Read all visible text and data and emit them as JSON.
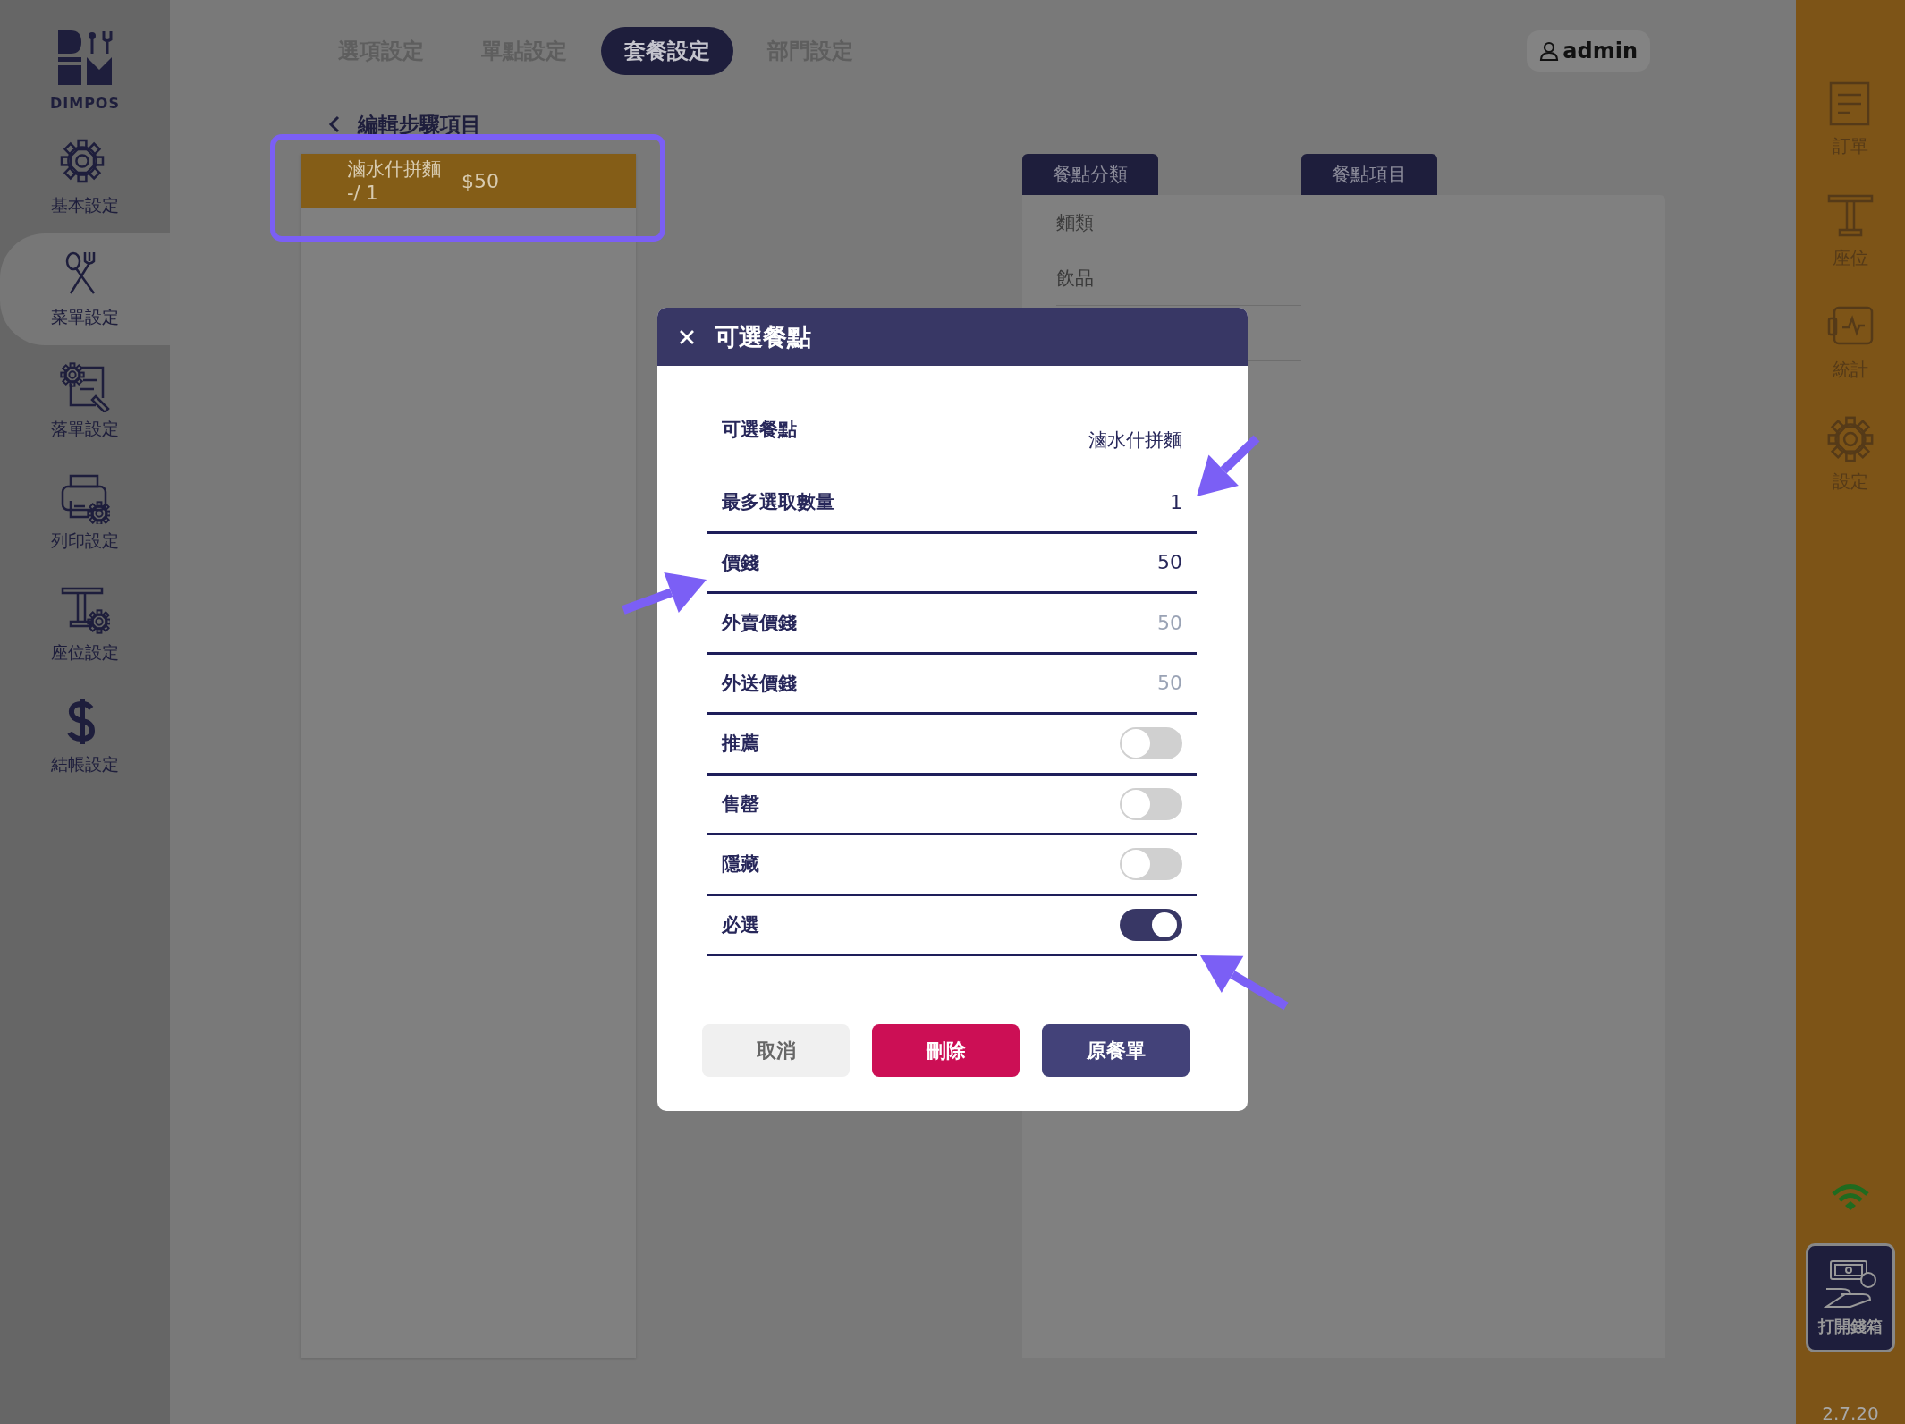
{
  "sidebar": {
    "logo_text": "DIMPOS",
    "items": [
      {
        "label": "基本設定",
        "selected": false
      },
      {
        "label": "菜單設定",
        "selected": true
      },
      {
        "label": "落單設定",
        "selected": false
      },
      {
        "label": "列印設定",
        "selected": false
      },
      {
        "label": "座位設定",
        "selected": false
      },
      {
        "label": "結帳設定",
        "selected": false
      }
    ]
  },
  "tabs": [
    {
      "label": "選項設定",
      "selected": false
    },
    {
      "label": "單點設定",
      "selected": false
    },
    {
      "label": "套餐設定",
      "selected": true
    },
    {
      "label": "部門設定",
      "selected": false
    }
  ],
  "user": {
    "name": "admin"
  },
  "back_title": "編輯步驟項目",
  "steps": [
    {
      "name": "滷水什拼麵 -/ 1",
      "price": "$50",
      "selected": true
    }
  ],
  "category_panel": {
    "title": "餐點分類",
    "items": [
      "麵類",
      "飲品"
    ]
  },
  "item_panel": {
    "title": "餐點項目"
  },
  "right_nav": {
    "items": [
      "訂單",
      "座位",
      "統計",
      "設定"
    ],
    "cash_button": "打開錢箱",
    "version": "2.7.20"
  },
  "dialog": {
    "title": "可選餐點",
    "rows": [
      {
        "kind": "text",
        "label": "可選餐點",
        "value": "滷水什拼麵"
      },
      {
        "kind": "input",
        "label": "最多選取數量",
        "value": "1"
      },
      {
        "kind": "input",
        "label": "價錢",
        "value": "50"
      },
      {
        "kind": "input",
        "label": "外賣價錢",
        "placeholder": "50"
      },
      {
        "kind": "input",
        "label": "外送價錢",
        "placeholder": "50"
      },
      {
        "kind": "toggle",
        "label": "推薦",
        "on": false
      },
      {
        "kind": "toggle",
        "label": "售罄",
        "on": false
      },
      {
        "kind": "toggle",
        "label": "隱藏",
        "on": false
      },
      {
        "kind": "toggle",
        "label": "必選",
        "on": true
      }
    ],
    "buttons": [
      {
        "kind": "cancel",
        "label": "取消"
      },
      {
        "kind": "delete",
        "label": "刪除"
      },
      {
        "kind": "primary",
        "label": "原餐單"
      }
    ]
  },
  "annotations": [
    {
      "kind": "highlight_box"
    },
    {
      "kind": "arrow"
    },
    {
      "kind": "arrow"
    },
    {
      "kind": "arrow"
    }
  ]
}
